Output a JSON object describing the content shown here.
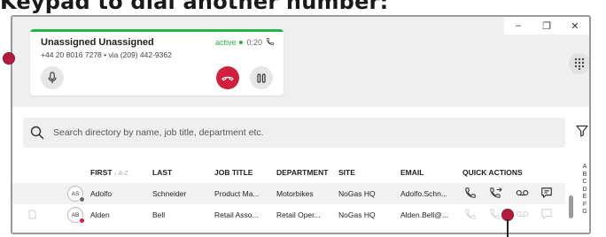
{
  "tutorial": {
    "caption": "Keypad to dial another number:"
  },
  "window": {
    "minimize": "–",
    "restore": "❐",
    "close": "✕"
  },
  "call": {
    "caller_name": "Unassigned Unassigned",
    "caller_number": "+44 20 8016 7278 • via (209) 442-9362",
    "status": "active",
    "timer": "0:20",
    "accent_color": "#2ab24a",
    "hangup_color": "#d0203d"
  },
  "search": {
    "placeholder": "Search directory by name, job title, department etc."
  },
  "table": {
    "columns": {
      "first": "FIRST",
      "first_sort": "A-Z",
      "last": "LAST",
      "job_title": "JOB TITLE",
      "department": "DEPARTMENT",
      "site": "SITE",
      "email": "EMAIL",
      "quick_actions": "QUICK ACTIONS"
    },
    "rows": [
      {
        "initials": "AS",
        "first": "Adolfo",
        "last": "Schneider",
        "job_title": "Product Ma...",
        "department": "Motorbikes",
        "site": "NoGas HQ",
        "email": "Adolfo.Schn...",
        "presence": "offline"
      },
      {
        "initials": "AB",
        "first": "Alden",
        "last": "Bell",
        "job_title": "Retail Asso...",
        "department": "Retail Oper...",
        "site": "NoGas HQ",
        "email": "Alden.Bell@...",
        "presence": "busy"
      }
    ]
  },
  "alpha_index": [
    "A",
    "B",
    "C",
    "D",
    "E",
    "F",
    "G"
  ],
  "icons": {
    "mute": "microphone-icon",
    "hangup": "hangup-icon",
    "hold": "pause-icon",
    "dialpad": "dialpad-icon",
    "search": "search-icon",
    "filter": "filter-icon",
    "call": "phone-icon",
    "transfer": "transfer-call-icon",
    "voicemail": "voicemail-icon",
    "chat": "chat-icon"
  },
  "pointer_color": "#b41a3c"
}
